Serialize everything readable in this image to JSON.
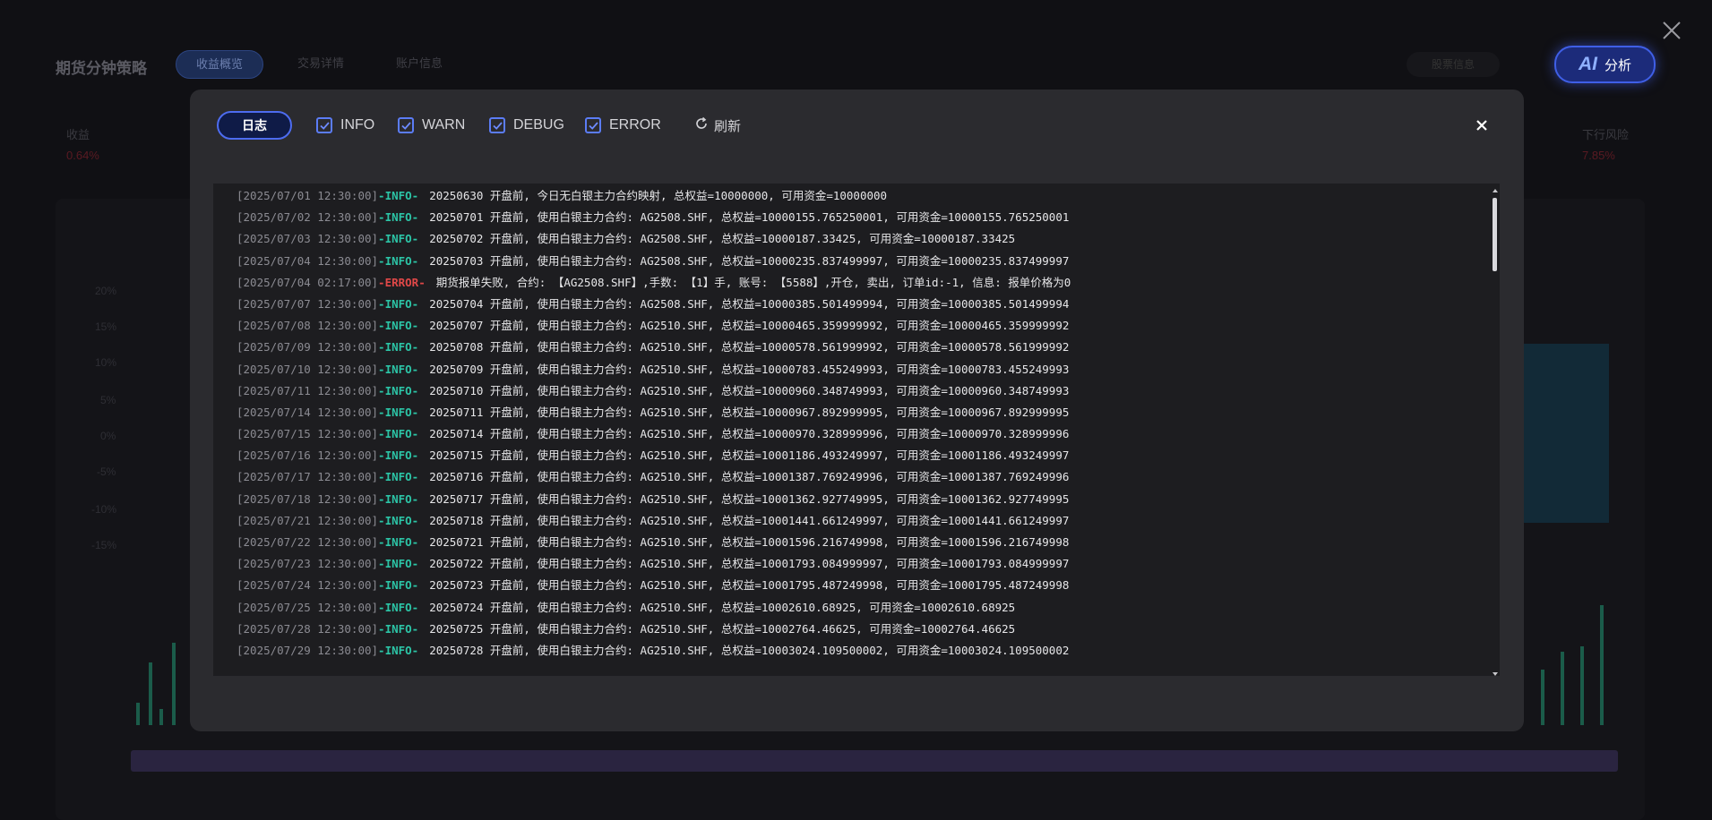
{
  "background": {
    "title": "期货分钟策略",
    "tabs": [
      "收益概览",
      "交易详情",
      "账户信息"
    ],
    "ghost_button": "股票信息",
    "ai_button": {
      "icon": "AI",
      "label": "分析"
    },
    "stat_left": {
      "label": "收益",
      "value": "0.64%"
    },
    "stat_right": {
      "label": "下行风险",
      "value": "7.85%"
    },
    "y_labels": [
      "20%",
      "15%",
      "10%",
      "5%",
      "0%",
      "-5%",
      "-10%",
      "-15%"
    ]
  },
  "modal": {
    "tab_label": "日志",
    "filters": [
      {
        "label": "INFO",
        "checked": true
      },
      {
        "label": "WARN",
        "checked": true
      },
      {
        "label": "DEBUG",
        "checked": true
      },
      {
        "label": "ERROR",
        "checked": true
      }
    ],
    "refresh_label": "刷新",
    "log_lines": [
      {
        "ts": "[2025/07/01 12:30:00]",
        "level": "-INFO-",
        "type": "info",
        "msg": "20250630 开盘前, 今日无白银主力合约映射, 总权益=10000000, 可用资金=10000000"
      },
      {
        "ts": "[2025/07/02 12:30:00]",
        "level": "-INFO-",
        "type": "info",
        "msg": "20250701 开盘前, 使用白银主力合约: AG2508.SHF, 总权益=10000155.765250001, 可用资金=10000155.765250001"
      },
      {
        "ts": "[2025/07/03 12:30:00]",
        "level": "-INFO-",
        "type": "info",
        "msg": "20250702 开盘前, 使用白银主力合约: AG2508.SHF, 总权益=10000187.33425, 可用资金=10000187.33425"
      },
      {
        "ts": "[2025/07/04 12:30:00]",
        "level": "-INFO-",
        "type": "info",
        "msg": "20250703 开盘前, 使用白银主力合约: AG2508.SHF, 总权益=10000235.837499997, 可用资金=10000235.837499997"
      },
      {
        "ts": "[2025/07/04 02:17:00]",
        "level": "-ERROR-",
        "type": "error",
        "msg": "期货报单失败, 合约: 【AG2508.SHF】,手数: 【1】手, 账号: 【5588】,开仓, 卖出, 订单id:-1, 信息: 报单价格为0"
      },
      {
        "ts": "[2025/07/07 12:30:00]",
        "level": "-INFO-",
        "type": "info",
        "msg": "20250704 开盘前, 使用白银主力合约: AG2508.SHF, 总权益=10000385.501499994, 可用资金=10000385.501499994"
      },
      {
        "ts": "[2025/07/08 12:30:00]",
        "level": "-INFO-",
        "type": "info",
        "msg": "20250707 开盘前, 使用白银主力合约: AG2510.SHF, 总权益=10000465.359999992, 可用资金=10000465.359999992"
      },
      {
        "ts": "[2025/07/09 12:30:00]",
        "level": "-INFO-",
        "type": "info",
        "msg": "20250708 开盘前, 使用白银主力合约: AG2510.SHF, 总权益=10000578.561999992, 可用资金=10000578.561999992"
      },
      {
        "ts": "[2025/07/10 12:30:00]",
        "level": "-INFO-",
        "type": "info",
        "msg": "20250709 开盘前, 使用白银主力合约: AG2510.SHF, 总权益=10000783.455249993, 可用资金=10000783.455249993"
      },
      {
        "ts": "[2025/07/11 12:30:00]",
        "level": "-INFO-",
        "type": "info",
        "msg": "20250710 开盘前, 使用白银主力合约: AG2510.SHF, 总权益=10000960.348749993, 可用资金=10000960.348749993"
      },
      {
        "ts": "[2025/07/14 12:30:00]",
        "level": "-INFO-",
        "type": "info",
        "msg": "20250711 开盘前, 使用白银主力合约: AG2510.SHF, 总权益=10000967.892999995, 可用资金=10000967.892999995"
      },
      {
        "ts": "[2025/07/15 12:30:00]",
        "level": "-INFO-",
        "type": "info",
        "msg": "20250714 开盘前, 使用白银主力合约: AG2510.SHF, 总权益=10000970.328999996, 可用资金=10000970.328999996"
      },
      {
        "ts": "[2025/07/16 12:30:00]",
        "level": "-INFO-",
        "type": "info",
        "msg": "20250715 开盘前, 使用白银主力合约: AG2510.SHF, 总权益=10001186.493249997, 可用资金=10001186.493249997"
      },
      {
        "ts": "[2025/07/17 12:30:00]",
        "level": "-INFO-",
        "type": "info",
        "msg": "20250716 开盘前, 使用白银主力合约: AG2510.SHF, 总权益=10001387.769249996, 可用资金=10001387.769249996"
      },
      {
        "ts": "[2025/07/18 12:30:00]",
        "level": "-INFO-",
        "type": "info",
        "msg": "20250717 开盘前, 使用白银主力合约: AG2510.SHF, 总权益=10001362.927749995, 可用资金=10001362.927749995"
      },
      {
        "ts": "[2025/07/21 12:30:00]",
        "level": "-INFO-",
        "type": "info",
        "msg": "20250718 开盘前, 使用白银主力合约: AG2510.SHF, 总权益=10001441.661249997, 可用资金=10001441.661249997"
      },
      {
        "ts": "[2025/07/22 12:30:00]",
        "level": "-INFO-",
        "type": "info",
        "msg": "20250721 开盘前, 使用白银主力合约: AG2510.SHF, 总权益=10001596.216749998, 可用资金=10001596.216749998"
      },
      {
        "ts": "[2025/07/23 12:30:00]",
        "level": "-INFO-",
        "type": "info",
        "msg": "20250722 开盘前, 使用白银主力合约: AG2510.SHF, 总权益=10001793.084999997, 可用资金=10001793.084999997"
      },
      {
        "ts": "[2025/07/24 12:30:00]",
        "level": "-INFO-",
        "type": "info",
        "msg": "20250723 开盘前, 使用白银主力合约: AG2510.SHF, 总权益=10001795.487249998, 可用资金=10001795.487249998"
      },
      {
        "ts": "[2025/07/25 12:30:00]",
        "level": "-INFO-",
        "type": "info",
        "msg": "20250724 开盘前, 使用白银主力合约: AG2510.SHF, 总权益=10002610.68925, 可用资金=10002610.68925"
      },
      {
        "ts": "[2025/07/28 12:30:00]",
        "level": "-INFO-",
        "type": "info",
        "msg": "20250725 开盘前, 使用白银主力合约: AG2510.SHF, 总权益=10002764.46625, 可用资金=10002764.46625"
      },
      {
        "ts": "[2025/07/29 12:30:00]",
        "level": "-INFO-",
        "type": "info",
        "msg": "20250728 开盘前, 使用白银主力合约: AG2510.SHF, 总权益=10003024.109500002, 可用资金=10003024.109500002"
      }
    ]
  },
  "colors": {
    "accent": "#4d6cf0",
    "info": "#2cc4a6",
    "error": "#e04848",
    "timestamp": "#8b8b92"
  },
  "icons": {
    "close": "close-icon",
    "refresh": "refresh-icon",
    "checkbox": "checkbox-checked-icon"
  }
}
